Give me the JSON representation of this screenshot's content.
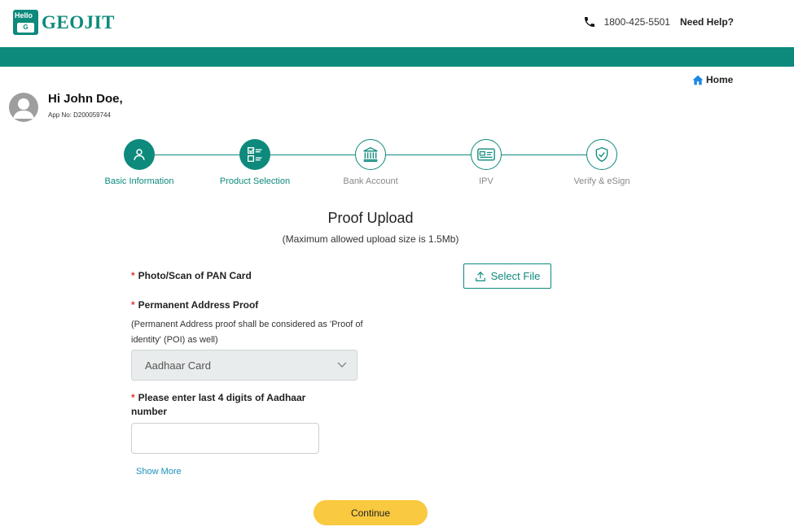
{
  "header": {
    "logo_hello": "Hello",
    "logo_glyph": "G",
    "logo_text": "GEOJIT",
    "phone": "1800-425-5501",
    "help": "Need Help?"
  },
  "nav": {
    "home_label": "Home"
  },
  "user": {
    "greeting": "Hi John Doe,",
    "app_no": "App No: D200059744"
  },
  "stepper": {
    "steps": [
      {
        "label": "Basic Information",
        "state": "done",
        "icon": "person-icon"
      },
      {
        "label": "Product Selection",
        "state": "done",
        "icon": "checklist-icon"
      },
      {
        "label": "Bank Account",
        "state": "todo",
        "icon": "bank-icon"
      },
      {
        "label": "IPV",
        "state": "todo",
        "icon": "id-card-icon"
      },
      {
        "label": "Verify & eSign",
        "state": "todo",
        "icon": "shield-check-icon"
      }
    ]
  },
  "form": {
    "title": "Proof Upload",
    "subtitle": "(Maximum allowed upload size is 1.5Mb)",
    "required_mark": "*",
    "pan_label": "Photo/Scan of PAN Card",
    "select_file_label": "Select File",
    "address_label": "Permanent Address Proof",
    "address_note": "(Permanent Address proof shall be considered as 'Proof of identity' (POI) as well)",
    "address_selected": "Aadhaar Card",
    "aadhaar_label": "Please enter last 4 digits of Aadhaar number",
    "aadhaar_value": "",
    "show_more": "Show More",
    "continue_label": "Continue"
  },
  "colors": {
    "brand": "#0d8a7c",
    "button_yellow": "#f9c93f",
    "required": "#e53935",
    "link": "#1a8fbf"
  }
}
